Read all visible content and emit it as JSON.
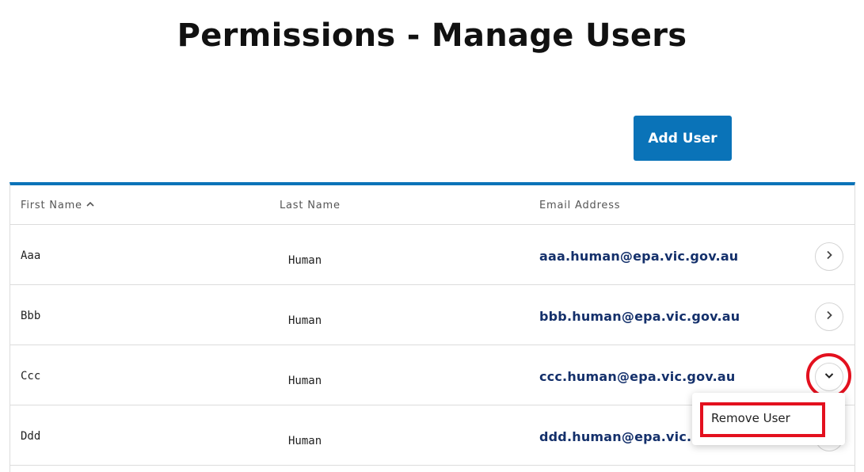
{
  "page": {
    "title": "Permissions - Manage Users"
  },
  "toolbar": {
    "add_user_label": "Add User"
  },
  "table": {
    "columns": [
      "First Name",
      "Last Name",
      "Email Address"
    ],
    "sort": {
      "column": "First Name",
      "direction": "ascending"
    },
    "rows": [
      {
        "first": "Aaa",
        "last": "Human",
        "email": "aaa.human@epa.vic.gov.au",
        "action_icon": "chevron-right-icon"
      },
      {
        "first": "Bbb",
        "last": "Human",
        "email": "bbb.human@epa.vic.gov.au",
        "action_icon": "chevron-right-icon"
      },
      {
        "first": "Ccc",
        "last": "Human",
        "email": "ccc.human@epa.vic.gov.au",
        "action_icon": "chevron-down-icon"
      },
      {
        "first": "Ddd",
        "last": "Human",
        "email": "ddd.human@epa.vic.",
        "action_icon": "chevron-right-icon"
      }
    ]
  },
  "dropdown": {
    "items": [
      "Remove User"
    ]
  },
  "colors": {
    "accent": "#0a73b8",
    "email_text": "#14306b",
    "annotation": "#e3101e"
  }
}
